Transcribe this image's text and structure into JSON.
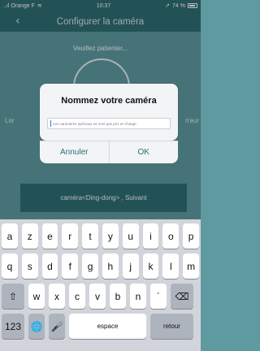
{
  "status": {
    "carrier": "..ıl Orange F",
    "wifi_icon": "wifi-icon",
    "time": "10:37",
    "location_arrow": "↗",
    "battery_percent": "74 %"
  },
  "nav": {
    "back_icon": "‹",
    "title": "Configurer la caméra"
  },
  "background": {
    "wait_text": "Veuillez patienter...",
    "left_link_text": "Lor",
    "right_link_text": "rreur",
    "bottom_button_text": "caméra<Ding-dong> , Suivant"
  },
  "dialog": {
    "title": "Nommez votre caméra",
    "placeholder": "Les caractères spéciaux ne sont pas pris en charge",
    "cancel_label": "Annuler",
    "ok_label": "OK"
  },
  "keyboard": {
    "row1": [
      "a",
      "z",
      "e",
      "r",
      "t",
      "y",
      "u",
      "i",
      "o",
      "p"
    ],
    "row2": [
      "q",
      "s",
      "d",
      "f",
      "g",
      "h",
      "j",
      "k",
      "l",
      "m"
    ],
    "row3": {
      "shift_icon": "⇧",
      "letters": [
        "w",
        "x",
        "c",
        "v",
        "b",
        "n",
        "´"
      ],
      "backspace_icon": "⌫"
    },
    "row4": {
      "numbers_label": "123",
      "globe_icon": "🌐",
      "mic_icon": "🎤",
      "space_label": "espace",
      "return_label": "retour"
    }
  }
}
